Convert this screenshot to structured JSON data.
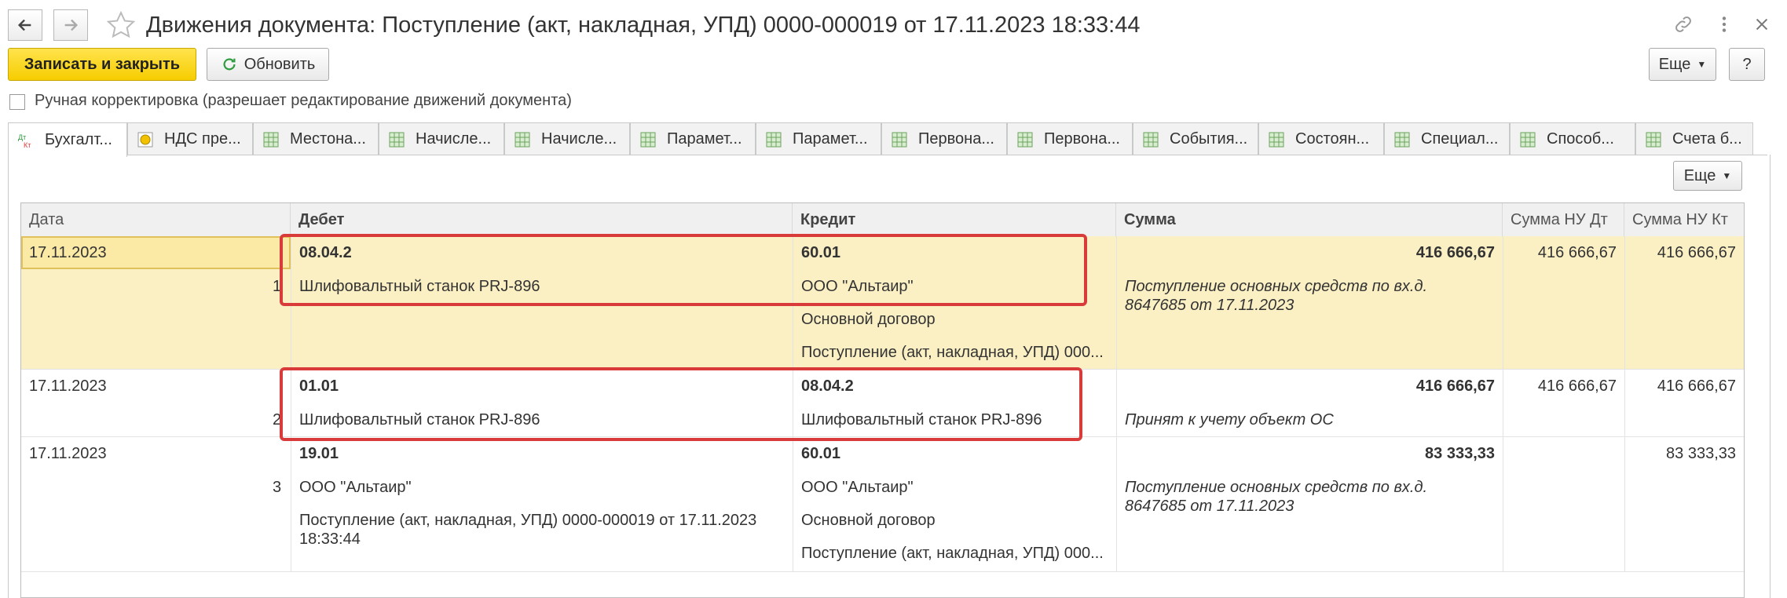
{
  "window": {
    "title": "Движения документа: Поступление (акт, накладная, УПД) 0000-000019 от 17.11.2023 18:33:44"
  },
  "toolbar": {
    "save_close_label": "Записать и закрыть",
    "refresh_label": "Обновить",
    "more_label": "Еще",
    "help_label": "?"
  },
  "manual_correction": {
    "label": "Ручная корректировка (разрешает редактирование движений документа)",
    "checked": false
  },
  "tabs": [
    {
      "label": "Бухгалт...",
      "icon": "dt-kt-icon",
      "active": true
    },
    {
      "label": "НДС пре...",
      "icon": "vat-icon",
      "active": false
    },
    {
      "label": "Местона...",
      "icon": "table-icon",
      "active": false
    },
    {
      "label": "Начисле...",
      "icon": "table-icon",
      "active": false
    },
    {
      "label": "Начисле...",
      "icon": "table-icon",
      "active": false
    },
    {
      "label": "Парамет...",
      "icon": "table-icon",
      "active": false
    },
    {
      "label": "Парамет...",
      "icon": "table-icon",
      "active": false
    },
    {
      "label": "Первона...",
      "icon": "table-icon",
      "active": false
    },
    {
      "label": "Первона...",
      "icon": "table-icon",
      "active": false
    },
    {
      "label": "События...",
      "icon": "table-icon",
      "active": false
    },
    {
      "label": "Состоян...",
      "icon": "table-icon",
      "active": false
    },
    {
      "label": "Специал...",
      "icon": "table-icon",
      "active": false
    },
    {
      "label": "Способ...",
      "icon": "table-icon",
      "active": false
    },
    {
      "label": "Счета б...",
      "icon": "table-icon",
      "active": false
    }
  ],
  "panel": {
    "more_label": "Еще"
  },
  "table": {
    "columns": [
      "Дата",
      "Дебет",
      "Кредит",
      "Сумма",
      "Сумма НУ Дт",
      "Сумма НУ Кт"
    ],
    "rows": [
      {
        "date": "17.11.2023",
        "num": "1",
        "debit_account": "08.04.2",
        "debit_lines": [
          "Шлифовальтный станок PRJ-896"
        ],
        "credit_account": "60.01",
        "credit_lines": [
          "ООО \"Альтаир\"",
          "Основной договор",
          "Поступление (акт, накладная, УПД) 000..."
        ],
        "sum": "416 666,67",
        "sum_nu_dt": "416 666,67",
        "sum_nu_kt": "416 666,67",
        "description": "Поступление основных средств по вх.д. 8647685 от 17.11.2023"
      },
      {
        "date": "17.11.2023",
        "num": "2",
        "debit_account": "01.01",
        "debit_lines": [
          "Шлифовальтный станок PRJ-896"
        ],
        "credit_account": "08.04.2",
        "credit_lines": [
          "Шлифовальтный станок PRJ-896"
        ],
        "sum": "416 666,67",
        "sum_nu_dt": "416 666,67",
        "sum_nu_kt": "416 666,67",
        "description": "Принят к учету объект ОС"
      },
      {
        "date": "17.11.2023",
        "num": "3",
        "debit_account": "19.01",
        "debit_lines": [
          "ООО \"Альтаир\"",
          "Поступление (акт, накладная, УПД) 0000-000019 от 17.11.2023 18:33:44"
        ],
        "credit_account": "60.01",
        "credit_lines": [
          "ООО \"Альтаир\"",
          "Основной договор",
          "Поступление (акт, накладная, УПД) 000..."
        ],
        "sum": "83 333,33",
        "sum_nu_dt": "",
        "sum_nu_kt": "83 333,33",
        "description": "Поступление основных средств по вх.д. 8647685 от 17.11.2023"
      }
    ]
  },
  "colors": {
    "primary_button": "#f6cd00",
    "selected_row": "#fbf0c4",
    "highlight_box": "#d93a3a"
  }
}
